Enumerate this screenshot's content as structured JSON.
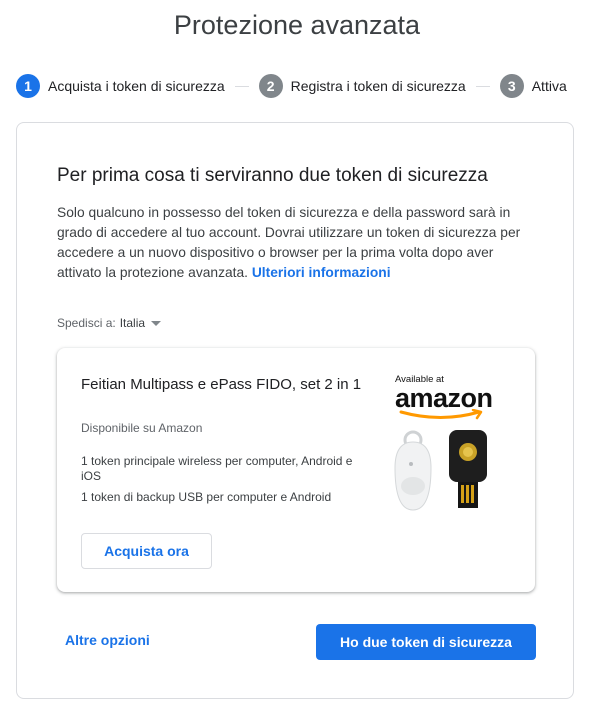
{
  "page": {
    "title": "Protezione avanzata"
  },
  "stepper": {
    "steps": [
      {
        "num": "1",
        "label": "Acquista i token di sicurezza"
      },
      {
        "num": "2",
        "label": "Registra i token di sicurezza"
      },
      {
        "num": "3",
        "label": "Attiva"
      }
    ]
  },
  "intro": {
    "heading": "Per prima cosa ti serviranno due token di sicurezza",
    "description": "Solo qualcuno in possesso del token di sicurezza e della password sarà in grado di accedere al tuo account. Dovrai utilizzare un token di sicurezza per accedere a un nuovo dispositivo o browser per la prima volta dopo aver attivato la protezione avanzata.",
    "learn_more": "Ulteriori informazioni"
  },
  "shipping": {
    "label": "Spedisci a:",
    "value": "Italia"
  },
  "product": {
    "name": "Feitian Multipass e ePass FIDO, set 2 in 1",
    "availability": "Disponibile su Amazon",
    "features": [
      "1 token principale wireless per computer, Android e iOS",
      "1 token di backup USB per computer e Android"
    ],
    "buy_label": "Acquista ora",
    "store_badge_top": "Available at",
    "store_badge_name": "amazon"
  },
  "actions": {
    "other_options": "Altre opzioni",
    "have_tokens": "Ho due token di sicurezza"
  },
  "colors": {
    "accent": "#1a73e8",
    "inactive_step": "#80868b",
    "border": "#dadce0"
  }
}
